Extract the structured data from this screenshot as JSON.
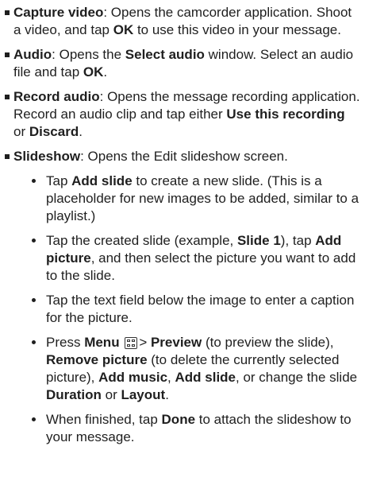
{
  "bullets": [
    {
      "term": "Capture video",
      "parts": [
        ": Opens the camcorder application. Shoot a video, and tap ",
        "OK",
        " to use this video in your message."
      ]
    },
    {
      "term": "Audio",
      "parts": [
        ": Opens the ",
        "Select audio",
        " window. Select an audio file and tap ",
        "OK",
        "."
      ]
    },
    {
      "term": "Record audio",
      "parts": [
        ": Opens the message recording application. Record an audio clip and tap either ",
        "Use this recording",
        " or ",
        "Discard",
        "."
      ]
    },
    {
      "term": "Slideshow",
      "parts": [
        ": Opens the Edit slideshow screen."
      ]
    }
  ],
  "sub": [
    {
      "parts": [
        "Tap ",
        "Add slide",
        " to create a new slide. (This is a placeholder for new images to be added, similar to a playlist.)"
      ]
    },
    {
      "parts": [
        "Tap the created slide (example, ",
        "Slide 1",
        "), tap ",
        "Add picture",
        ", and then select the picture you want to add to the slide."
      ]
    },
    {
      "parts": [
        "Tap the text field below the image to enter a caption for the picture."
      ]
    },
    {
      "parts": [
        "Press ",
        "Menu",
        " ",
        "> ",
        "Preview",
        " (to preview the slide), ",
        "Remove picture",
        " (to delete the currently selected picture), ",
        "Add music",
        ", ",
        "Add slide",
        ", or change the slide ",
        "Duration",
        " or ",
        "Layout",
        "."
      ]
    },
    {
      "parts": [
        "When finished, tap ",
        "Done",
        " to attach the slideshow to your message."
      ]
    }
  ],
  "icons": {
    "menu": "menu-key-icon"
  }
}
